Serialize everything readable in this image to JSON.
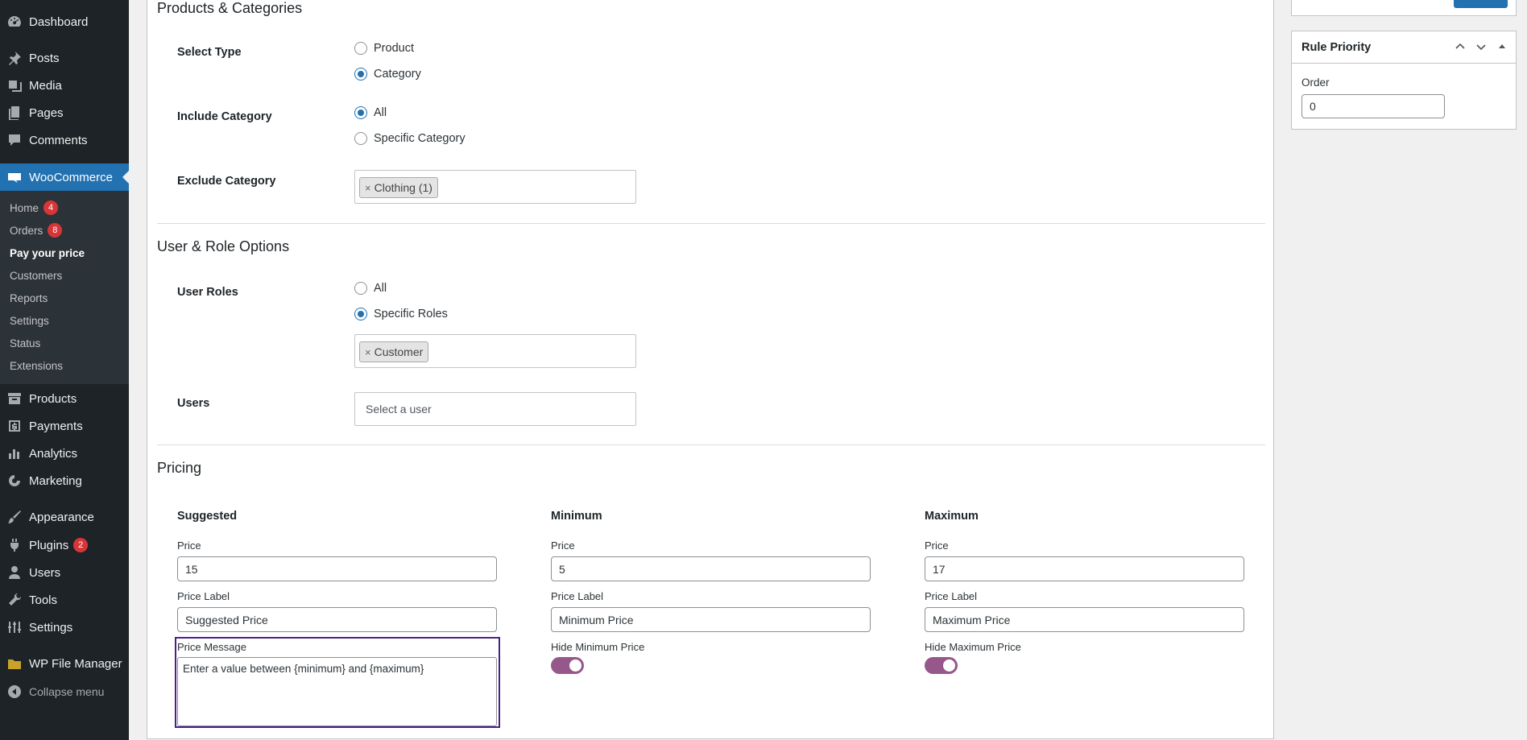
{
  "sidebar": {
    "top_items": [
      {
        "label": "Dashboard",
        "icon": "dashboard-icon"
      },
      {
        "label": "Posts",
        "icon": "pin-icon"
      },
      {
        "label": "Media",
        "icon": "media-icon"
      },
      {
        "label": "Pages",
        "icon": "pages-icon"
      },
      {
        "label": "Comments",
        "icon": "comment-icon"
      }
    ],
    "woocommerce": {
      "label": "WooCommerce",
      "icon": "woo-icon"
    },
    "sub_items": [
      {
        "label": "Home",
        "badge": "4"
      },
      {
        "label": "Orders",
        "badge": "8"
      },
      {
        "label": "Pay your price"
      },
      {
        "label": "Customers"
      },
      {
        "label": "Reports"
      },
      {
        "label": "Settings"
      },
      {
        "label": "Status"
      },
      {
        "label": "Extensions"
      }
    ],
    "bottom_items": [
      {
        "label": "Products",
        "icon": "archive-icon"
      },
      {
        "label": "Payments",
        "icon": "dollar-icon"
      },
      {
        "label": "Analytics",
        "icon": "chart-bar-icon"
      },
      {
        "label": "Marketing",
        "icon": "megaphone-icon"
      },
      {
        "label": "Appearance",
        "icon": "brush-icon"
      },
      {
        "label": "Plugins",
        "icon": "plugin-icon",
        "badge": "2"
      },
      {
        "label": "Users",
        "icon": "user-icon"
      },
      {
        "label": "Tools",
        "icon": "wrench-icon"
      },
      {
        "label": "Settings",
        "icon": "settings-icon"
      },
      {
        "label": "WP File Manager",
        "icon": "folder-icon"
      },
      {
        "label": "Collapse menu",
        "icon": "collapse-icon"
      }
    ]
  },
  "products_categories": {
    "title": "Products & Categories",
    "select_type": {
      "label": "Select Type",
      "options": [
        "Product",
        "Category"
      ],
      "selected": "Category"
    },
    "include_category": {
      "label": "Include Category",
      "options": [
        "All",
        "Specific Category"
      ],
      "selected": "All"
    },
    "exclude_category": {
      "label": "Exclude Category",
      "tags": [
        "Clothing (1)"
      ],
      "remove_glyph": "×"
    }
  },
  "user_role": {
    "title": "User & Role Options",
    "user_roles": {
      "label": "User Roles",
      "options": [
        "All",
        "Specific Roles"
      ],
      "selected": "Specific Roles",
      "tags": [
        "Customer"
      ]
    },
    "users": {
      "label": "Users",
      "placeholder": "Select a user"
    }
  },
  "pricing": {
    "title": "Pricing",
    "suggested": {
      "heading": "Suggested",
      "price_label": "Price",
      "price": "15",
      "label_label": "Price Label",
      "label_value": "Suggested Price",
      "message_label": "Price Message",
      "message_value": "Enter a value between {minimum} and {maximum}"
    },
    "minimum": {
      "heading": "Minimum",
      "price_label": "Price",
      "price": "5",
      "label_label": "Price Label",
      "label_value": "Minimum Price",
      "hide_label": "Hide Minimum Price",
      "hide_on": true
    },
    "maximum": {
      "heading": "Maximum",
      "price_label": "Price",
      "price": "17",
      "label_label": "Price Label",
      "label_value": "Maximum Price",
      "hide_label": "Hide Maximum Price",
      "hide_on": true
    }
  },
  "rule_priority": {
    "title": "Rule Priority",
    "order_label": "Order",
    "order_value": "0"
  },
  "colors": {
    "accent": "#2271b1",
    "toggle": "#96588a",
    "sidebar": "#1d2327",
    "badge": "#d63638"
  }
}
